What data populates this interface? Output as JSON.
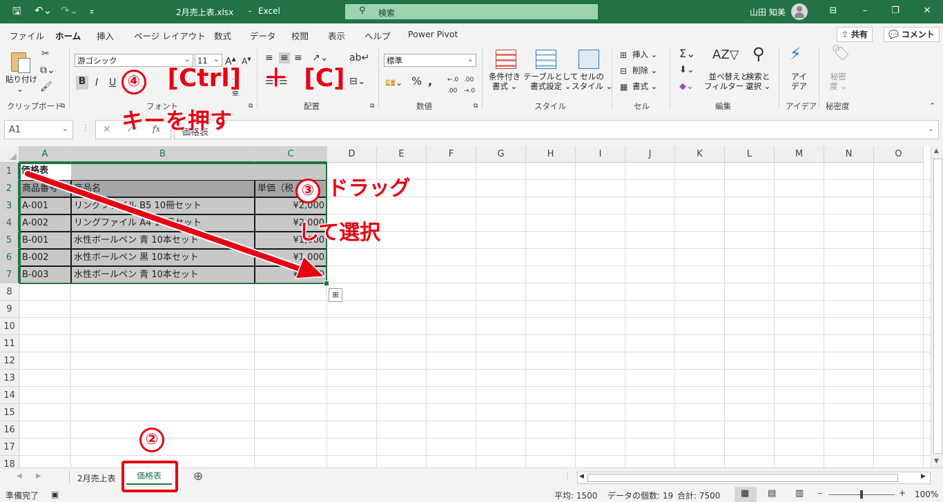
{
  "titlebar": {
    "filename": "2月売上表.xlsx",
    "separator": "-",
    "app": "Excel",
    "search_placeholder": "検索",
    "user": "山田 知美"
  },
  "colors": {
    "accent": "#217346",
    "annotation": "#e60012",
    "selection": "#c8c8c8",
    "header_fill": "#a6a6a6"
  },
  "ribbon_tabs": [
    "ファイル",
    "ホーム",
    "挿入",
    "ページ レイアウト",
    "数式",
    "データ",
    "校閲",
    "表示",
    "ヘルプ",
    "Power Pivot"
  ],
  "share_label": "共有",
  "comment_label": "コメント",
  "ribbon": {
    "paste_label": "貼り付け",
    "font_name": "游ゴシック",
    "font_size": "11",
    "number_format": "標準",
    "cond_format": [
      "条件付き",
      "書式"
    ],
    "table_format": [
      "テーブルとして",
      "書式設定"
    ],
    "cell_style": [
      "セルの",
      "スタイル"
    ],
    "insert": "挿入",
    "delete": "削除",
    "format": "書式",
    "sort_filter": [
      "並べ替えと",
      "フィルター"
    ],
    "find_select": [
      "検索と",
      "選択"
    ],
    "ideas": [
      "アイ",
      "デア"
    ],
    "sensitivity": [
      "秘密",
      "度"
    ],
    "groups": [
      "クリップボード",
      "フォント",
      "配置",
      "数値",
      "スタイル",
      "セル",
      "編集",
      "アイデア",
      "秘密度"
    ]
  },
  "formula_bar": {
    "name_box": "A1",
    "fx": "fx",
    "content": "価格表"
  },
  "columns": [
    "A",
    "B",
    "C",
    "D",
    "E",
    "F",
    "G",
    "H",
    "I",
    "J",
    "K",
    "L",
    "M",
    "N",
    "O"
  ],
  "rows": [
    "1",
    "2",
    "3",
    "4",
    "5",
    "6",
    "7",
    "8",
    "9",
    "10",
    "11",
    "12",
    "13",
    "14",
    "15",
    "16",
    "17",
    "18"
  ],
  "table": {
    "title": "価格表",
    "headers": [
      "商品番号",
      "商品名",
      "単価（税"
    ],
    "rows": [
      [
        "A-001",
        "リングファイル B5 10冊セット",
        "¥2,000"
      ],
      [
        "A-002",
        "リングファイル A4 10冊セット",
        "¥2,000"
      ],
      [
        "B-001",
        "水性ボールペン 青 10本セット",
        "¥1,000"
      ],
      [
        "B-002",
        "水性ボールペン 黒 10本セット",
        "¥1,000"
      ],
      [
        "B-003",
        "水性ボールペン 青 10本セット",
        "¥1,500"
      ]
    ]
  },
  "sheets": [
    "2月売上表",
    "価格表"
  ],
  "status": {
    "ready": "準備完了",
    "average": "平均: 1500",
    "count": "データの個数: 19",
    "sum": "合計: 7500",
    "zoom": "100%"
  },
  "annotations": {
    "step2": "②",
    "step3_num": "③",
    "step3_line1": "ドラッグ",
    "step3_line2": "して選択",
    "step4_num": "④",
    "step4_keys_a": "[Ctrl]",
    "step4_plus": "＋",
    "step4_keys_b": "[C]",
    "step4_line2": "キーを押す"
  }
}
